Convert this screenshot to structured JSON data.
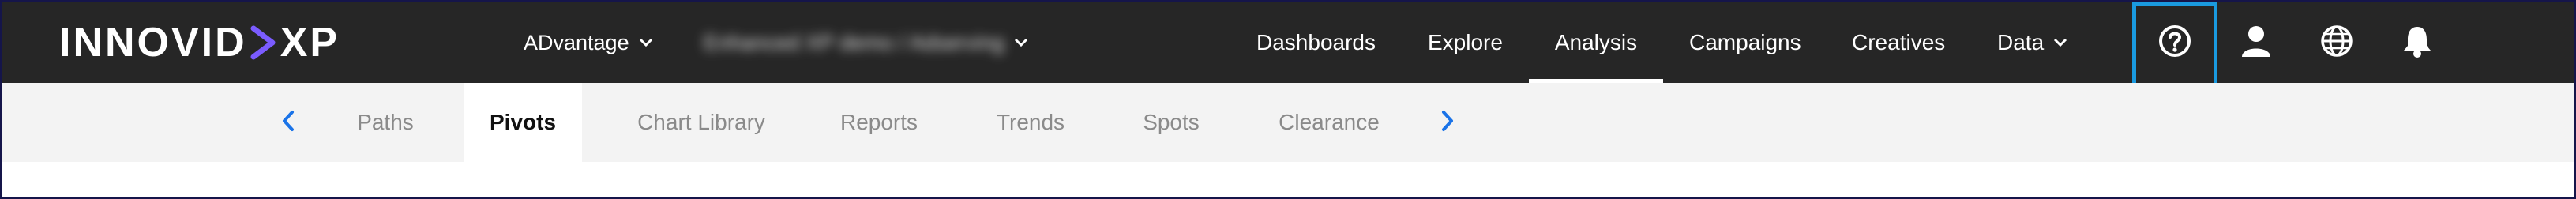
{
  "brand": {
    "logo_left": "INNOVID",
    "logo_right": "XP"
  },
  "account": {
    "name": "ADvantage",
    "workspace": "Enhanced XP demo / Adserving"
  },
  "topnav": {
    "items": [
      {
        "label": "Dashboards"
      },
      {
        "label": "Explore"
      },
      {
        "label": "Analysis",
        "active": true
      },
      {
        "label": "Campaigns"
      },
      {
        "label": "Creatives"
      },
      {
        "label": "Data"
      }
    ],
    "icons": [
      "help-icon",
      "user-icon",
      "globe-icon",
      "bell-icon"
    ]
  },
  "subnav": {
    "tabs": [
      {
        "label": "Paths"
      },
      {
        "label": "Pivots",
        "active": true
      },
      {
        "label": "Chart Library"
      },
      {
        "label": "Reports"
      },
      {
        "label": "Trends"
      },
      {
        "label": "Spots"
      },
      {
        "label": "Clearance"
      }
    ]
  },
  "colors": {
    "topbar_bg": "#262626",
    "subbar_bg": "#f3f3f3",
    "accent_blue": "#1a73e8",
    "highlight_blue": "#1a9ae0",
    "logo_accent": "#7b5cff"
  }
}
